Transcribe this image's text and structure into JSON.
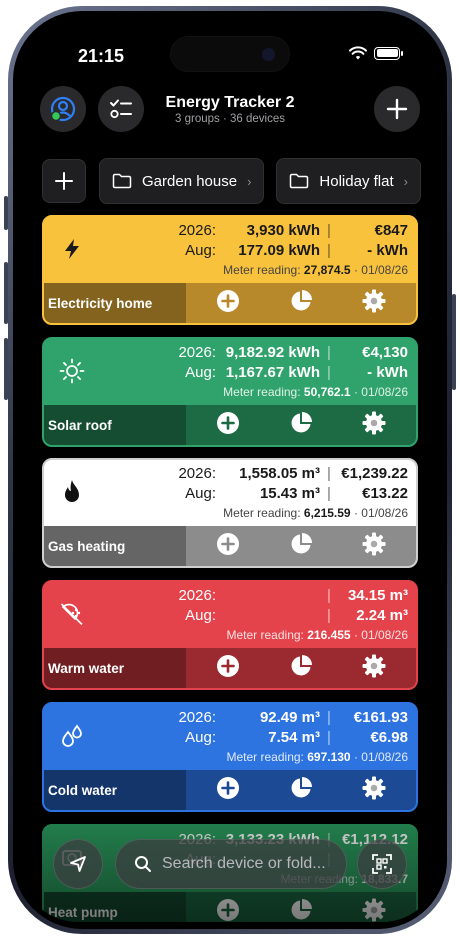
{
  "status": {
    "time": "21:15"
  },
  "header": {
    "title": "Energy Tracker 2",
    "subtitle": "3 groups · 36 devices"
  },
  "groups": [
    {
      "label": "Garden house"
    },
    {
      "label": "Holiday flat"
    }
  ],
  "cards": [
    {
      "name": "Electricity home",
      "icon": "lightning-icon",
      "color": "#f9c23c",
      "dark": "#b8892a",
      "year_label": "2026:",
      "year_value": "3,930 kWh",
      "year_cost": "€847",
      "month_label": "Aug:",
      "month_value": "177.09 kWh",
      "month_cost": "- kWh",
      "meter_label": "Meter reading:",
      "meter_value": "27,874.5",
      "meter_date": "· 01/08/26"
    },
    {
      "name": "Solar roof",
      "icon": "sun-icon",
      "color": "#2fa36b",
      "dark": "#1c6b45",
      "year_label": "2026:",
      "year_value": "9,182.92 kWh",
      "year_cost": "€4,130",
      "month_label": "Aug:",
      "month_value": "1,167.67 kWh",
      "month_cost": "- kWh",
      "meter_label": "Meter reading:",
      "meter_value": "50,762.1",
      "meter_date": "· 01/08/26"
    },
    {
      "name": "Gas heating",
      "icon": "flame-icon",
      "color": "#ffffff",
      "dark": "#8c8c8c",
      "year_label": "2026:",
      "year_value": "1,558.05 m³",
      "year_cost": "€1,239.22",
      "month_label": "Aug:",
      "month_value": "15.43 m³",
      "month_cost": "€13.22",
      "meter_label": "Meter reading:",
      "meter_value": "6,215.59",
      "meter_date": "· 01/08/26"
    },
    {
      "name": "Warm water",
      "icon": "shower-icon",
      "color": "#e5434c",
      "dark": "#9b2a30",
      "year_label": "2026:",
      "year_value": "",
      "year_cost": "34.15 m³",
      "month_label": "Aug:",
      "month_value": "",
      "month_cost": "2.24 m³",
      "meter_label": "Meter reading:",
      "meter_value": "216.455",
      "meter_date": "· 01/08/26"
    },
    {
      "name": "Cold water",
      "icon": "droplets-icon",
      "color": "#2e74e0",
      "dark": "#1c4a94",
      "year_label": "2026:",
      "year_value": "92.49 m³",
      "year_cost": "€161.93",
      "month_label": "Aug:",
      "month_value": "7.54 m³",
      "month_cost": "€6.98",
      "meter_label": "Meter reading:",
      "meter_value": "697.130",
      "meter_date": "· 01/08/26"
    },
    {
      "name": "Heat pump",
      "icon": "heat-pump-icon",
      "color": "#2b9a5d",
      "dark": "#1b6640",
      "year_label": "2026:",
      "year_value": "3,133.23 kWh",
      "year_cost": "€1,112.12",
      "month_label": "Aug:",
      "month_value": "",
      "month_cost": "",
      "meter_label": "Meter reading:",
      "meter_value": "18,833.7",
      "meter_date": ""
    }
  ],
  "search": {
    "placeholder": "Search device or fold..."
  }
}
